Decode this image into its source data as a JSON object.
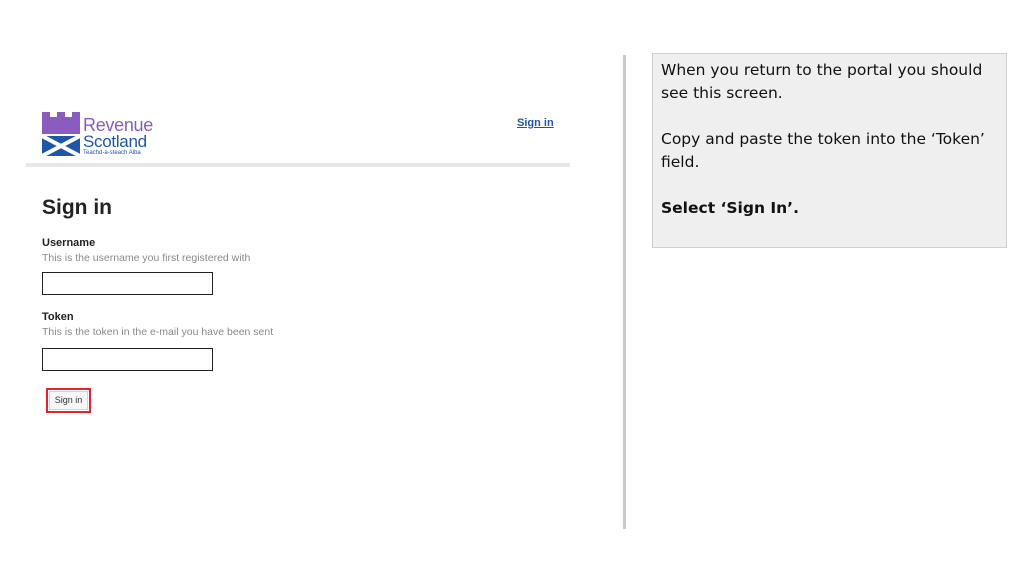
{
  "logo": {
    "line1": "Revenue",
    "line2": "Scotland",
    "line3": "Teachd-a-steach Alba"
  },
  "header": {
    "signin_link": "Sign in"
  },
  "form": {
    "title": "Sign in",
    "username": {
      "label": "Username",
      "hint": "This is the username you first registered with",
      "value": ""
    },
    "token": {
      "label": "Token",
      "hint": "This is the token in the e-mail you have been sent",
      "value": ""
    },
    "submit_label": "Sign in"
  },
  "instructions": {
    "p1": "When you return to the portal you should see this screen.",
    "p2": "Copy and paste the token into the ‘Token’ field.",
    "p3": "Select ‘Sign In’."
  },
  "colors": {
    "logo_purple": "#8a5cc0",
    "logo_blue": "#1f57a8",
    "highlight_red": "#e0262b",
    "note_bg": "#efefef"
  }
}
